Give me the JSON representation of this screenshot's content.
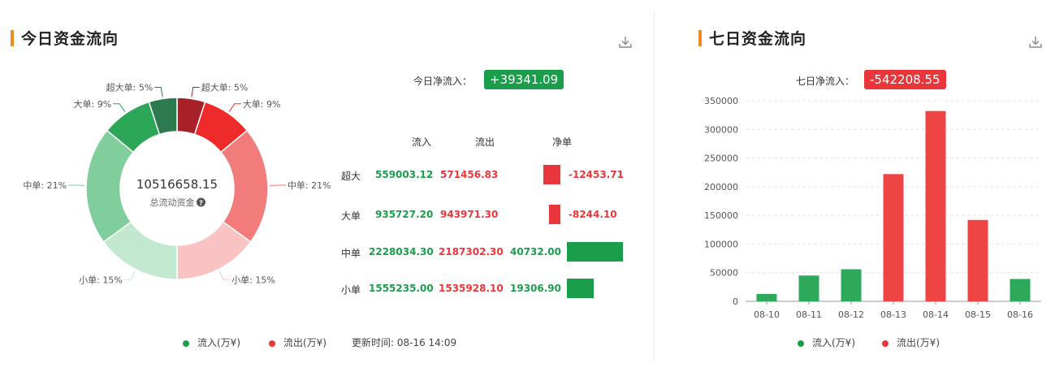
{
  "today": {
    "title": "今日资金流向",
    "net_label": "今日净流入：",
    "net_value": "+39341.09",
    "table": {
      "headers": {
        "inflow": "流入",
        "outflow": "流出",
        "net": "净单"
      },
      "rows": [
        {
          "label": "超大",
          "inflow": "559003.12",
          "outflow": "571456.83",
          "net": "-12453.71",
          "net_value": -12453.71
        },
        {
          "label": "大单",
          "inflow": "935727.20",
          "outflow": "943971.30",
          "net": "-8244.10",
          "net_value": -8244.1
        },
        {
          "label": "中单",
          "inflow": "2228034.30",
          "outflow": "2187302.30",
          "net": "40732.00",
          "net_value": 40732.0
        },
        {
          "label": "小单",
          "inflow": "1555235.00",
          "outflow": "1535928.10",
          "net": "19306.90",
          "net_value": 19306.9
        }
      ]
    },
    "legend": {
      "inflow": "流入(万¥)",
      "outflow": "流出(万¥)",
      "update": "更新时间: 08-16 14:09"
    }
  },
  "seven": {
    "title": "七日资金流向",
    "net_label": "七日净流入：",
    "net_value": "-542208.55",
    "legend": {
      "inflow": "流入(万¥)",
      "outflow": "流出(万¥)"
    }
  },
  "colors": {
    "green": "#1b9e4b",
    "red": "#e8363a",
    "accent": "#f08a24"
  },
  "chart_data": [
    {
      "type": "pie",
      "variant": "donut",
      "center_value": "10516658.15",
      "center_label": "总流动资金",
      "slices": [
        {
          "label": "超大单",
          "percent": 5,
          "side": "outflow",
          "color": "#a82128"
        },
        {
          "label": "大单",
          "percent": 9,
          "side": "outflow",
          "color": "#ee2a2a"
        },
        {
          "label": "中单",
          "percent": 21,
          "side": "outflow",
          "color": "#f27c7c"
        },
        {
          "label": "小单",
          "percent": 15,
          "side": "outflow",
          "color": "#f9c3c3"
        },
        {
          "label": "小单",
          "percent": 15,
          "side": "inflow",
          "color": "#c2e9cf"
        },
        {
          "label": "中单",
          "percent": 21,
          "side": "inflow",
          "color": "#80ce9c"
        },
        {
          "label": "大单",
          "percent": 9,
          "side": "inflow",
          "color": "#2ca757"
        },
        {
          "label": "超大单",
          "percent": 5,
          "side": "inflow",
          "color": "#2c7a4e"
        }
      ]
    },
    {
      "type": "bar",
      "categories": [
        "08-10",
        "08-11",
        "08-12",
        "08-13",
        "08-14",
        "08-15",
        "08-16"
      ],
      "values": [
        13000,
        45000,
        56000,
        222000,
        332000,
        142000,
        39000
      ],
      "direction": [
        "inflow",
        "inflow",
        "inflow",
        "outflow",
        "outflow",
        "outflow",
        "inflow"
      ],
      "ylim": [
        0,
        350000
      ],
      "yticks": [
        0,
        50000,
        100000,
        150000,
        200000,
        250000,
        300000,
        350000
      ],
      "grid": true
    }
  ]
}
